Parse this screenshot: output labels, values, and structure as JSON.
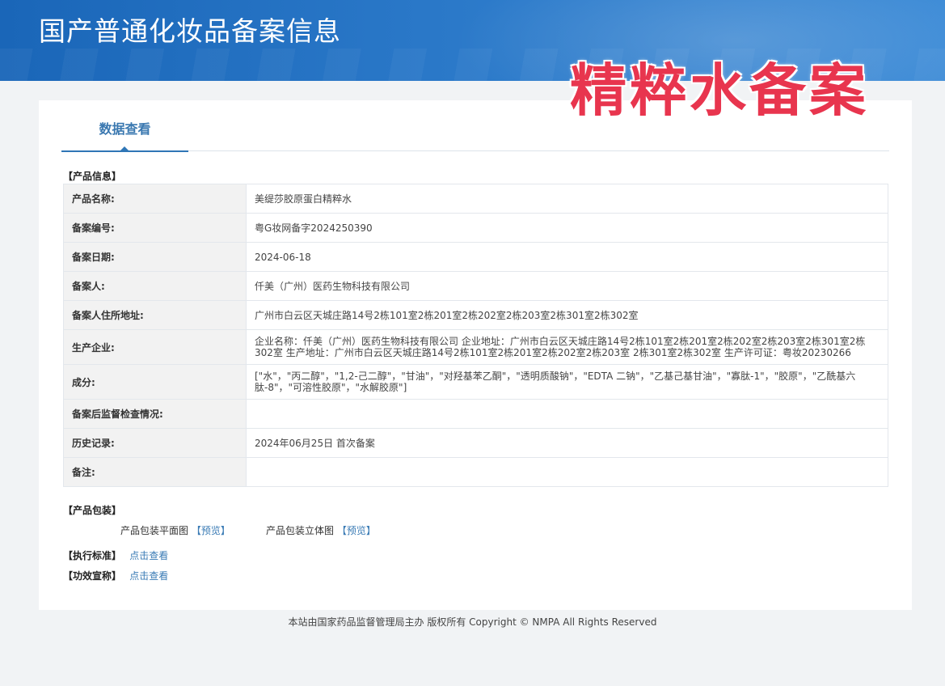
{
  "header": {
    "site_title": "国产普通化妆品备案信息"
  },
  "watermark": {
    "text": "精粹水备案"
  },
  "tabs": [
    {
      "label": "数据查看"
    }
  ],
  "product_info": {
    "section_title": "【产品信息】",
    "rows": [
      {
        "label": "产品名称:",
        "value": "美缇莎胶原蛋白精粹水"
      },
      {
        "label": "备案编号:",
        "value": "粤G妆网备字2024250390"
      },
      {
        "label": "备案日期:",
        "value": "2024-06-18"
      },
      {
        "label": "备案人:",
        "value": "仟美（广州）医药生物科技有限公司"
      },
      {
        "label": "备案人住所地址:",
        "value": "广州市白云区天城庄路14号2栋101室2栋201室2栋202室2栋203室2栋301室2栋302室"
      },
      {
        "label": "生产企业:",
        "value": "企业名称：仟美（广州）医药生物科技有限公司 企业地址：广州市白云区天城庄路14号2栋101室2栋201室2栋202室2栋203室2栋301室2栋302室 生产地址：广州市白云区天城庄路14号2栋101室2栋201室2栋202室2栋203室 2栋301室2栋302室 生产许可证：粤妆20230266"
      },
      {
        "label": "成分:",
        "value": "[\"水\"，\"丙二醇\"，\"1,2-己二醇\"，\"甘油\"，\"对羟基苯乙酮\"，\"透明质酸钠\"，\"EDTA 二钠\"，\"乙基己基甘油\"，\"寡肽-1\"，\"胶原\"，\"乙酰基六肽-8\"，\"可溶性胶原\"，\"水解胶原\"]"
      },
      {
        "label": "备案后监督检查情况:",
        "value": ""
      },
      {
        "label": "历史记录:",
        "value": "2024年06月25日 首次备案"
      },
      {
        "label": "备注:",
        "value": ""
      }
    ]
  },
  "packaging": {
    "section_title": "【产品包装】",
    "flat_label": "产品包装平面图",
    "flat_link": "【预览】",
    "solid_label": "产品包装立体图",
    "solid_link": "【预览】"
  },
  "standard": {
    "section_title": "【执行标准】",
    "link": "点击查看"
  },
  "efficacy": {
    "section_title": "【功效宣称】",
    "link": "点击查看"
  },
  "footer": {
    "text": "本站由国家药品监督管理局主办 版权所有 Copyright © NMPA All Rights Reserved"
  }
}
